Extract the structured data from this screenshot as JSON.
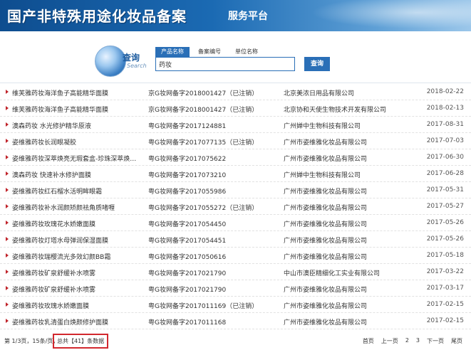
{
  "header": {
    "title": "国产非特殊用途化妆品备案",
    "subtitle": "服务平台"
  },
  "search": {
    "label_cn": "查询",
    "label_en": "Search",
    "tabs": [
      "产品名称",
      "备案编号",
      "单位名称"
    ],
    "active_tab": 0,
    "query": "药妆",
    "button_label": "查询"
  },
  "results": [
    {
      "name": "维芙雅药妆海洋鱼子高能精华面膜",
      "cert": "京G妆网备字2018001427（已注销）",
      "company": "北京美浓日用品有限公司",
      "date": "2018-02-22"
    },
    {
      "name": "维芙雅药妆海洋鱼子高能精华面膜",
      "cert": "京G妆网备字2018001427（已注销）",
      "company": "北京协和天使生物技术开发有限公司",
      "date": "2018-02-13"
    },
    {
      "name": "澳森药妆 水光修护精华原液",
      "cert": "粤G妆网备字2017124881",
      "company": "广州婵中生物科技有限公司",
      "date": "2017-08-31"
    },
    {
      "name": "姿维雅药妆长润眼凝胶",
      "cert": "粤G妆网备字2017077135（已注销）",
      "company": "广州市姿维雅化妆品有限公司",
      "date": "2017-07-03"
    },
    {
      "name": "姿维雅药妆深萃焕亮无瑕套盒-珍珠深萃焕…",
      "cert": "粤G妆网备字2017075622",
      "company": "广州市姿维雅化妆品有限公司",
      "date": "2017-06-30"
    },
    {
      "name": "澳森药妆 快速补水修护面膜",
      "cert": "粤G妆网备字2017073210",
      "company": "广州婵中生物科技有限公司",
      "date": "2017-06-28"
    },
    {
      "name": "姿维雅药妆红石榴水活明眸眼霜",
      "cert": "粤G妆网备字2017055986",
      "company": "广州市姿维雅化妆品有限公司",
      "date": "2017-05-31"
    },
    {
      "name": "姿维雅药妆补水润颜矫颜祛角质啫喱",
      "cert": "粤G妆网备字2017055272（已注销）",
      "company": "广州市姿维雅化妆品有限公司",
      "date": "2017-05-27"
    },
    {
      "name": "姿维雅药妆玫瑰花水娇嫩面膜",
      "cert": "粤G妆网备字2017054450",
      "company": "广州市姿维雅化妆品有限公司",
      "date": "2017-05-26"
    },
    {
      "name": "姿维雅药妆灯塔水母弹润保湿面膜",
      "cert": "粤G妆网备字2017054451",
      "company": "广州市姿维雅化妆品有限公司",
      "date": "2017-05-26"
    },
    {
      "name": "姿维雅药妆瑞樱流光多效幻颜BB霜",
      "cert": "粤G妆网备字2017050616",
      "company": "广州市姿维雅化妆品有限公司",
      "date": "2017-05-18"
    },
    {
      "name": "姿维雅药妆矿泉舒缓补水喷雾",
      "cert": "粤G妆网备字2017021790",
      "company": "中山市澳臣精细化工实业有限公司",
      "date": "2017-03-22"
    },
    {
      "name": "姿维雅药妆矿泉舒缓补水喷雾",
      "cert": "粤G妆网备字2017021790",
      "company": "广州市姿维雅化妆品有限公司",
      "date": "2017-03-17"
    },
    {
      "name": "姿维雅药妆玫瑰水娇嫩面膜",
      "cert": "粤G妆网备字2017011169（已注销）",
      "company": "广州市姿维雅化妆品有限公司",
      "date": "2017-02-15"
    },
    {
      "name": "姿维雅药妆乳清蛋白焕颜修护面膜",
      "cert": "粤G妆网备字2017011168",
      "company": "广州市姿维雅化妆品有限公司",
      "date": "2017-02-15"
    }
  ],
  "pager": {
    "info": "第 1/3页，15条/页，",
    "total": "总共【41】条数据",
    "links": [
      "首页",
      "上一页",
      "2",
      "3",
      "下一页",
      "尾页"
    ]
  }
}
